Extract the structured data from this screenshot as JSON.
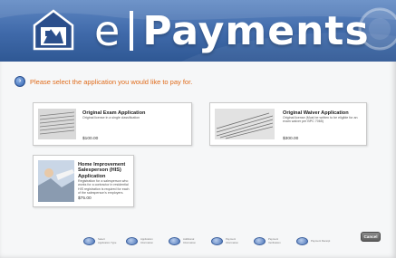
{
  "header": {
    "brand_prefix": "e",
    "brand_name": "Payments"
  },
  "instruction": {
    "text": "Please select the application you would like to pay for."
  },
  "applications": [
    {
      "title": "Original Exam Application",
      "description": "Original license in a single classification",
      "price": "$100.00"
    },
    {
      "title": "Original Waiver Application",
      "description": "Original license (Must be written to be eligible for an exam waiver per BPC 7065)",
      "price": "$300.00"
    },
    {
      "title": "Home Improvement Salesperson (HIS) Application",
      "description": "Registration for a salesperson who works for a contractor in residential HIS registration is required for each of the salesperson's employers.",
      "price": "$75.00"
    }
  ],
  "actions": {
    "cancel_label": "Cancel"
  },
  "steps": [
    {
      "label": "Select Application Type"
    },
    {
      "label": "Application Information"
    },
    {
      "label": "Additional Information"
    },
    {
      "label": "Payment Information"
    },
    {
      "label": "Payment Verification"
    },
    {
      "label": "Payment Receipt"
    }
  ],
  "colors": {
    "header_blue": "#3f69a9",
    "instruction_orange": "#e06c1c",
    "step_active": "#4a74b8",
    "cancel_gray": "#5e5e5e"
  }
}
